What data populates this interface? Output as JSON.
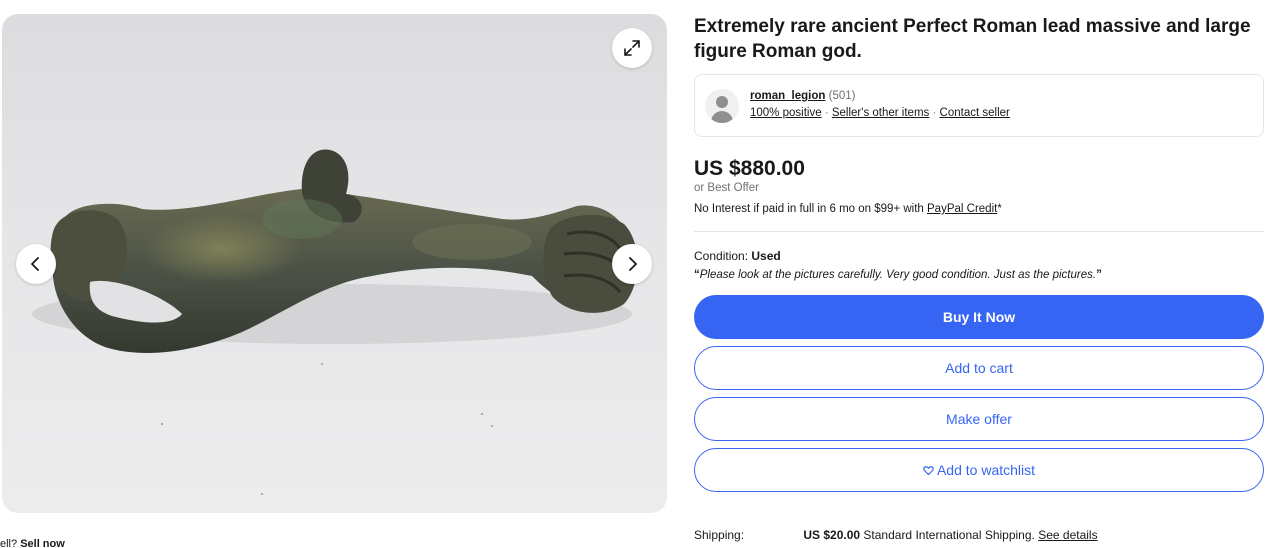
{
  "gallery": {
    "image_alt": "Ancient lead Roman figure",
    "expand_icon": "expand-icon",
    "prev_icon": "chevron-left-icon",
    "next_icon": "chevron-right-icon",
    "sell_prefix": "ell?",
    "sell_link": "Sell now"
  },
  "item": {
    "title": "Extremely rare ancient Perfect Roman lead massive and large figure Roman god."
  },
  "seller": {
    "name": "roman_legion",
    "feedback_count": "(501)",
    "positive": "100% positive",
    "separator": "·",
    "other_items": "Seller's other items",
    "contact": "Contact seller"
  },
  "pricing": {
    "price": "US $880.00",
    "best_offer": "or Best Offer",
    "credit_text": "No Interest if paid in full in 6 mo on $99+ with",
    "credit_link": "PayPal Credit",
    "credit_suffix": "*"
  },
  "condition": {
    "label": "Condition:",
    "value": "Used",
    "quote_open": "“",
    "quote": "Please look at the pictures carefully. Very good condition. Just as the pictures.",
    "quote_close": "”"
  },
  "actions": {
    "buy_now": "Buy It Now",
    "add_to_cart": "Add to cart",
    "make_offer": "Make offer",
    "watchlist": "Add to watchlist"
  },
  "shipping": {
    "label": "Shipping:",
    "cost": "US $20.00",
    "method": "Standard International Shipping.",
    "details_link": "See details"
  },
  "colors": {
    "accent": "#3665f3",
    "text": "#191919",
    "muted": "#707070"
  }
}
